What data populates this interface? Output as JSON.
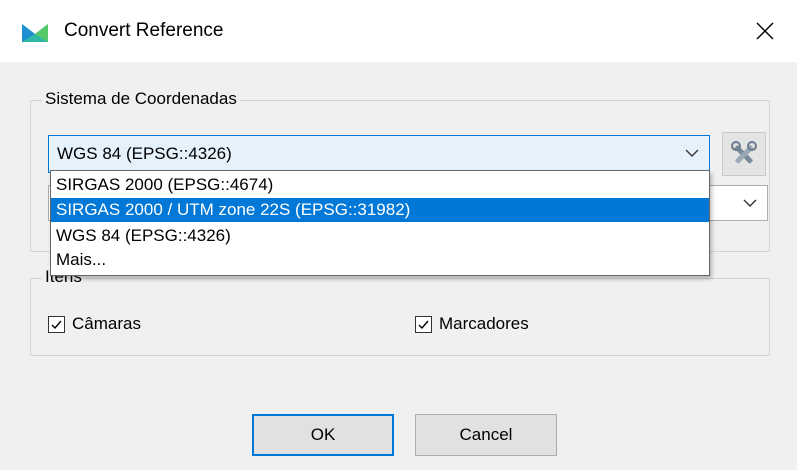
{
  "window": {
    "title": "Convert Reference"
  },
  "coord_group": {
    "label": "Sistema de Coordenadas",
    "selected": "WGS 84 (EPSG::4326)",
    "options": [
      {
        "label": "SIRGAS 2000 (EPSG::4674)",
        "selected": false
      },
      {
        "label": "SIRGAS 2000 / UTM zone 22S (EPSG::31982)",
        "selected": true
      },
      {
        "label": "WGS 84 (EPSG::4326)",
        "selected": false
      },
      {
        "label": "Mais...",
        "selected": false
      }
    ],
    "second_combo_value": ""
  },
  "items_group": {
    "label": "Itens",
    "checkboxes": [
      {
        "label": "Câmaras",
        "checked": true
      },
      {
        "label": "Marcadores",
        "checked": true
      }
    ]
  },
  "buttons": {
    "ok": "OK",
    "cancel": "Cancel"
  },
  "colors": {
    "selection": "#0078d7",
    "background": "#f0f0f0"
  }
}
